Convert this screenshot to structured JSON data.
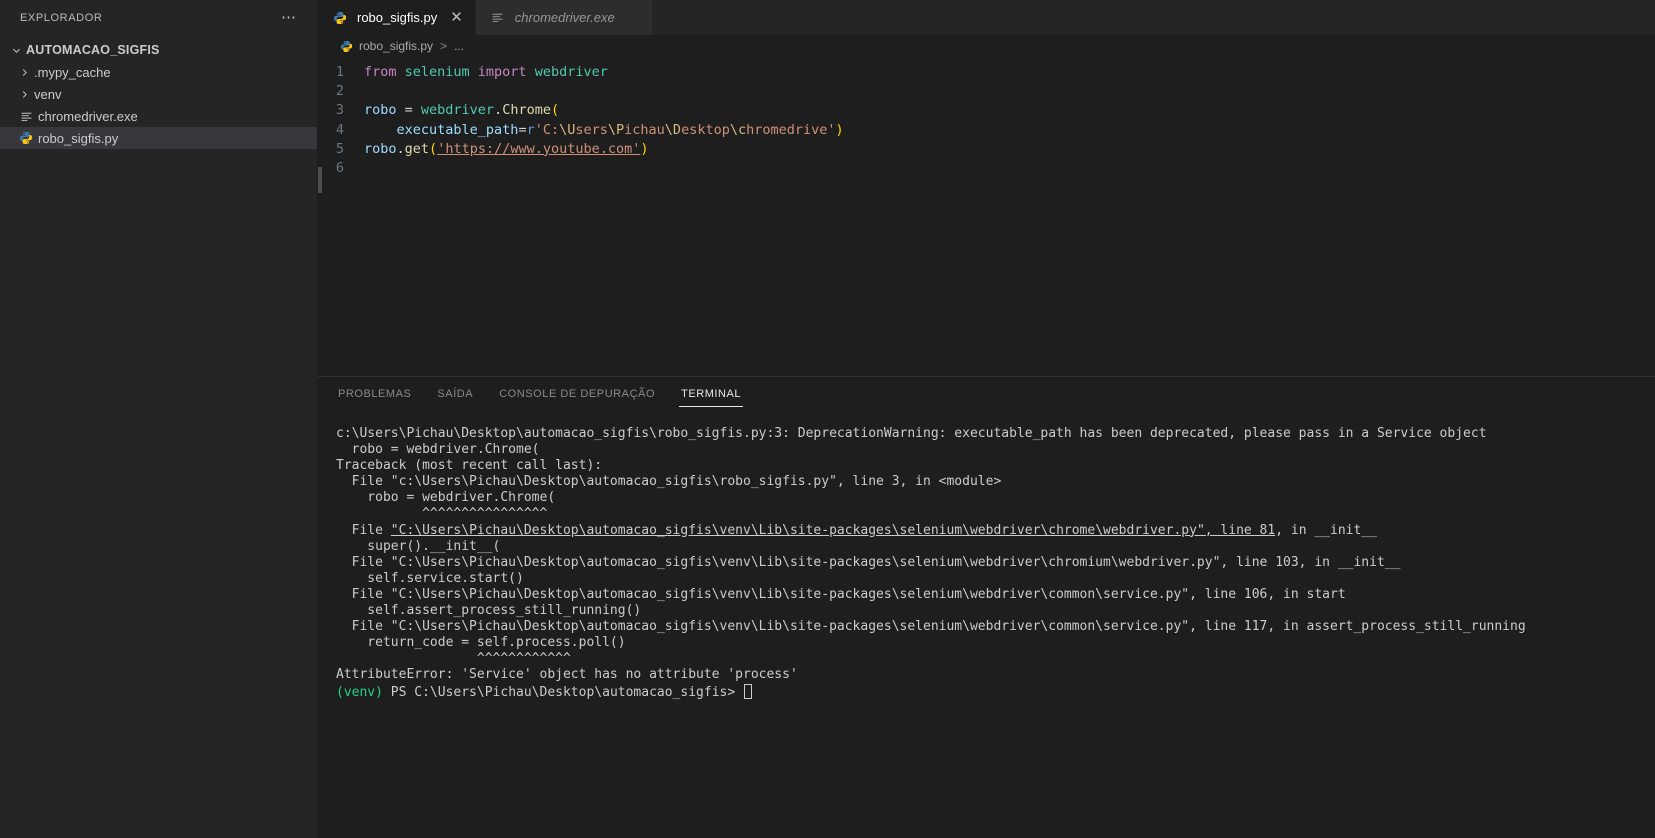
{
  "sidebar": {
    "title": "EXPLORADOR",
    "actions_icon": "ellipsis-icon",
    "root": {
      "label": "AUTOMACAO_SIGFIS",
      "expanded": true
    },
    "items": [
      {
        "label": ".mypy_cache",
        "type": "folder",
        "expanded": false,
        "icon": "chevron-right-icon"
      },
      {
        "label": "venv",
        "type": "folder",
        "expanded": false,
        "icon": "chevron-right-icon"
      },
      {
        "label": "chromedriver.exe",
        "type": "file",
        "icon": "binary-file-icon",
        "selected": false
      },
      {
        "label": "robo_sigfis.py",
        "type": "file",
        "icon": "python-file-icon",
        "selected": true
      }
    ]
  },
  "tabs": [
    {
      "label": "robo_sigfis.py",
      "icon": "python-file-icon",
      "active": true,
      "preview": false,
      "close_icon": "close-icon"
    },
    {
      "label": "chromedriver.exe",
      "icon": "binary-file-icon",
      "active": false,
      "preview": true,
      "close_icon": "close-icon"
    }
  ],
  "breadcrumb": {
    "icon": "python-file-icon",
    "file": "robo_sigfis.py",
    "separator": ">",
    "more": "..."
  },
  "editor": {
    "lines": [
      {
        "n": "1",
        "tokens": [
          {
            "t": "from ",
            "c": "kw"
          },
          {
            "t": "selenium ",
            "c": "cls"
          },
          {
            "t": "import ",
            "c": "kw"
          },
          {
            "t": "webdriver",
            "c": "cls"
          }
        ]
      },
      {
        "n": "2",
        "tokens": []
      },
      {
        "n": "3",
        "tokens": [
          {
            "t": "robo ",
            "c": "var"
          },
          {
            "t": "= ",
            "c": "op"
          },
          {
            "t": "webdriver",
            "c": "cls"
          },
          {
            "t": ".",
            "c": "op"
          },
          {
            "t": "Chrome",
            "c": "fn"
          },
          {
            "t": "(",
            "c": "par1"
          }
        ]
      },
      {
        "n": "4",
        "tokens": [
          {
            "t": "    ",
            "c": "ind-guide"
          },
          {
            "t": "executable_path",
            "c": "var"
          },
          {
            "t": "=",
            "c": "op"
          },
          {
            "t": "r",
            "c": "pre"
          },
          {
            "t": "'C:",
            "c": "str"
          },
          {
            "t": "\\U",
            "c": "esc"
          },
          {
            "t": "sers",
            "c": "str"
          },
          {
            "t": "\\P",
            "c": "esc"
          },
          {
            "t": "ichau",
            "c": "str"
          },
          {
            "t": "\\D",
            "c": "esc"
          },
          {
            "t": "esktop",
            "c": "str"
          },
          {
            "t": "\\c",
            "c": "esc"
          },
          {
            "t": "hromedrive'",
            "c": "str"
          },
          {
            "t": ")",
            "c": "par1"
          }
        ]
      },
      {
        "n": "5",
        "tokens": [
          {
            "t": "robo",
            "c": "var"
          },
          {
            "t": ".",
            "c": "op"
          },
          {
            "t": "get",
            "c": "fn"
          },
          {
            "t": "(",
            "c": "par1"
          },
          {
            "t": "'https://www.youtube.com'",
            "c": "str link-str"
          },
          {
            "t": ")",
            "c": "par1"
          }
        ]
      },
      {
        "n": "6",
        "tokens": []
      }
    ]
  },
  "panel": {
    "tabs": [
      {
        "label": "PROBLEMAS",
        "active": false
      },
      {
        "label": "SAÍDA",
        "active": false
      },
      {
        "label": "CONSOLE DE DEPURAÇÃO",
        "active": false
      },
      {
        "label": "TERMINAL",
        "active": true
      }
    ],
    "terminal_lines": [
      {
        "segments": [
          {
            "t": "c:\\Users\\Pichau\\Desktop\\automacao_sigfis\\robo_sigfis.py:3: DeprecationWarning: executable_path has been deprecated, please pass in a Service object"
          }
        ]
      },
      {
        "segments": [
          {
            "t": "  robo = webdriver.Chrome("
          }
        ]
      },
      {
        "segments": [
          {
            "t": "Traceback (most recent call last):"
          }
        ]
      },
      {
        "segments": [
          {
            "t": "  File \"c:\\Users\\Pichau\\Desktop\\automacao_sigfis\\robo_sigfis.py\", line 3, in <module>"
          }
        ]
      },
      {
        "segments": [
          {
            "t": "    robo = webdriver.Chrome("
          }
        ]
      },
      {
        "segments": [
          {
            "t": "           ^^^^^^^^^^^^^^^^"
          }
        ]
      },
      {
        "segments": [
          {
            "t": ""
          }
        ]
      },
      {
        "segments": [
          {
            "t": "  File "
          },
          {
            "t": "\"C:\\Users\\Pichau\\Desktop\\automacao_sigfis\\venv\\Lib\\site-packages\\selenium\\webdriver\\chrome\\webdriver.py\", line 81",
            "c": "t-link"
          },
          {
            "t": ", in __init__"
          }
        ]
      },
      {
        "segments": [
          {
            "t": "    super().__init__("
          }
        ]
      },
      {
        "segments": [
          {
            "t": "  File \"C:\\Users\\Pichau\\Desktop\\automacao_sigfis\\venv\\Lib\\site-packages\\selenium\\webdriver\\chromium\\webdriver.py\", line 103, in __init__"
          }
        ]
      },
      {
        "segments": [
          {
            "t": "    self.service.start()"
          }
        ]
      },
      {
        "segments": [
          {
            "t": "  File \"C:\\Users\\Pichau\\Desktop\\automacao_sigfis\\venv\\Lib\\site-packages\\selenium\\webdriver\\common\\service.py\", line 106, in start"
          }
        ]
      },
      {
        "segments": [
          {
            "t": "    self.assert_process_still_running()"
          }
        ]
      },
      {
        "segments": [
          {
            "t": "  File \"C:\\Users\\Pichau\\Desktop\\automacao_sigfis\\venv\\Lib\\site-packages\\selenium\\webdriver\\common\\service.py\", line 117, in assert_process_still_running"
          }
        ]
      },
      {
        "segments": [
          {
            "t": "    return_code = self.process.poll()"
          }
        ]
      },
      {
        "segments": [
          {
            "t": "                  ^^^^^^^^^^^^"
          }
        ]
      },
      {
        "segments": [
          {
            "t": ""
          }
        ]
      },
      {
        "segments": [
          {
            "t": "AttributeError: 'Service' object has no attribute 'process'"
          }
        ]
      },
      {
        "segments": [
          {
            "t": "(venv)",
            "c": "t-venv"
          },
          {
            "t": " PS C:\\Users\\Pichau\\Desktop\\automacao_sigfis> "
          }
        ],
        "cursor": true
      }
    ]
  },
  "colors": {
    "editor_bg": "#1e1e1e",
    "sidebar_bg": "#252526",
    "tab_inactive_bg": "#2d2d2d",
    "selection_bg": "#37373d",
    "text": "#cccccc",
    "accent_green": "#23d18b",
    "keyword": "#c586c0",
    "string": "#ce9178",
    "class": "#4ec9b0",
    "variable": "#9cdcfe",
    "function": "#dcdcaa"
  }
}
